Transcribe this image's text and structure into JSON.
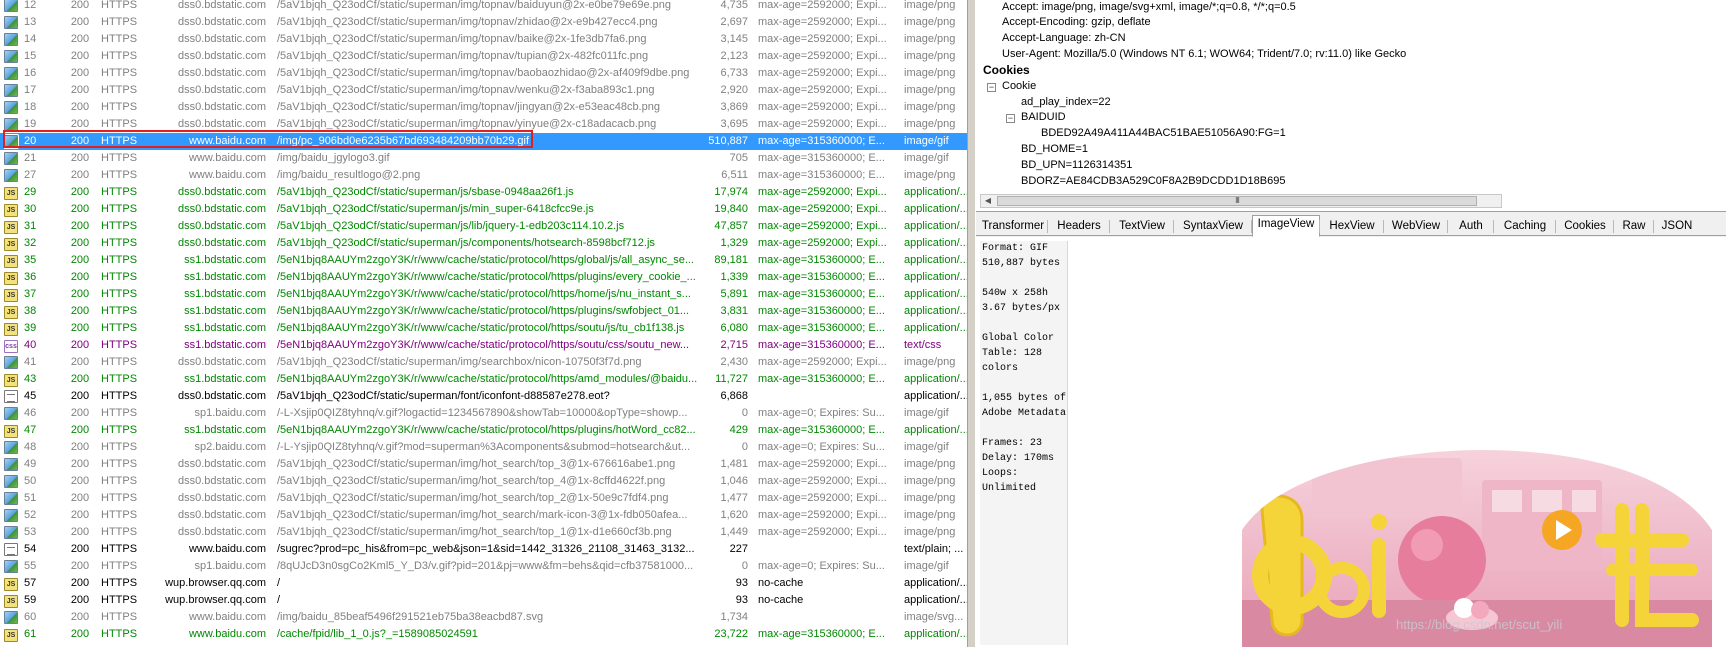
{
  "sessions": [
    {
      "num": "12",
      "result": "200",
      "protocol": "HTTPS",
      "host": "dss0.bdstatic.com",
      "url": "/5aV1bjqh_Q23odCf/static/superman/img/topnav/baiduyun@2x-e0be79e69e.png",
      "body": "4,735",
      "caching": "max-age=2592000; Expi...",
      "ctype": "image/png",
      "icon": "image-icon",
      "style": "gray"
    },
    {
      "num": "13",
      "result": "200",
      "protocol": "HTTPS",
      "host": "dss0.bdstatic.com",
      "url": "/5aV1bjqh_Q23odCf/static/superman/img/topnav/zhidao@2x-e9b427ecc4.png",
      "body": "2,697",
      "caching": "max-age=2592000; Expi...",
      "ctype": "image/png",
      "icon": "image-icon",
      "style": "gray"
    },
    {
      "num": "14",
      "result": "200",
      "protocol": "HTTPS",
      "host": "dss0.bdstatic.com",
      "url": "/5aV1bjqh_Q23odCf/static/superman/img/topnav/baike@2x-1fe3db7fa6.png",
      "body": "3,145",
      "caching": "max-age=2592000; Expi...",
      "ctype": "image/png",
      "icon": "image-icon",
      "style": "gray"
    },
    {
      "num": "15",
      "result": "200",
      "protocol": "HTTPS",
      "host": "dss0.bdstatic.com",
      "url": "/5aV1bjqh_Q23odCf/static/superman/img/topnav/tupian@2x-482fc011fc.png",
      "body": "2,123",
      "caching": "max-age=2592000; Expi...",
      "ctype": "image/png",
      "icon": "image-icon",
      "style": "gray"
    },
    {
      "num": "16",
      "result": "200",
      "protocol": "HTTPS",
      "host": "dss0.bdstatic.com",
      "url": "/5aV1bjqh_Q23odCf/static/superman/img/topnav/baobaozhidao@2x-af409f9dbe.png",
      "body": "6,733",
      "caching": "max-age=2592000; Expi...",
      "ctype": "image/png",
      "icon": "image-icon",
      "style": "gray"
    },
    {
      "num": "17",
      "result": "200",
      "protocol": "HTTPS",
      "host": "dss0.bdstatic.com",
      "url": "/5aV1bjqh_Q23odCf/static/superman/img/topnav/wenku@2x-f3aba893c1.png",
      "body": "2,920",
      "caching": "max-age=2592000; Expi...",
      "ctype": "image/png",
      "icon": "image-icon",
      "style": "gray"
    },
    {
      "num": "18",
      "result": "200",
      "protocol": "HTTPS",
      "host": "dss0.bdstatic.com",
      "url": "/5aV1bjqh_Q23odCf/static/superman/img/topnav/jingyan@2x-e53eac48cb.png",
      "body": "3,869",
      "caching": "max-age=2592000; Expi...",
      "ctype": "image/png",
      "icon": "image-icon",
      "style": "gray"
    },
    {
      "num": "19",
      "result": "200",
      "protocol": "HTTPS",
      "host": "dss0.bdstatic.com",
      "url": "/5aV1bjqh_Q23odCf/static/superman/img/topnav/yinyue@2x-c18adacacb.png",
      "body": "3,695",
      "caching": "max-age=2592000; Expi...",
      "ctype": "image/png",
      "icon": "image-icon",
      "style": "gray"
    },
    {
      "num": "20",
      "result": "200",
      "protocol": "HTTPS",
      "host": "www.baidu.com",
      "url": "/img/pc_906bd0e6235b67bd693484209bb70b29.gif",
      "body": "510,887",
      "caching": "max-age=315360000; E...",
      "ctype": "image/gif",
      "icon": "image-icon",
      "style": "selected"
    },
    {
      "num": "21",
      "result": "200",
      "protocol": "HTTPS",
      "host": "www.baidu.com",
      "url": "/img/baidu_jgylogo3.gif",
      "body": "705",
      "caching": "max-age=315360000; E...",
      "ctype": "image/gif",
      "icon": "image-icon",
      "style": "gray"
    },
    {
      "num": "27",
      "result": "200",
      "protocol": "HTTPS",
      "host": "www.baidu.com",
      "url": "/img/baidu_resultlogo@2.png",
      "body": "6,511",
      "caching": "max-age=315360000; E...",
      "ctype": "image/png",
      "icon": "image-icon",
      "style": "gray"
    },
    {
      "num": "29",
      "result": "200",
      "protocol": "HTTPS",
      "host": "dss0.bdstatic.com",
      "url": "/5aV1bjqh_Q23odCf/static/superman/js/sbase-0948aa26f1.js",
      "body": "17,974",
      "caching": "max-age=2592000; Expi...",
      "ctype": "application/...",
      "icon": "js-icon",
      "style": "green"
    },
    {
      "num": "30",
      "result": "200",
      "protocol": "HTTPS",
      "host": "dss0.bdstatic.com",
      "url": "/5aV1bjqh_Q23odCf/static/superman/js/min_super-6418cfcc9e.js",
      "body": "19,840",
      "caching": "max-age=2592000; Expi...",
      "ctype": "application/...",
      "icon": "js-icon",
      "style": "green"
    },
    {
      "num": "31",
      "result": "200",
      "protocol": "HTTPS",
      "host": "dss0.bdstatic.com",
      "url": "/5aV1bjqh_Q23odCf/static/superman/js/lib/jquery-1-edb203c114.10.2.js",
      "body": "47,857",
      "caching": "max-age=2592000; Expi...",
      "ctype": "application/...",
      "icon": "js-icon",
      "style": "green"
    },
    {
      "num": "32",
      "result": "200",
      "protocol": "HTTPS",
      "host": "dss0.bdstatic.com",
      "url": "/5aV1bjqh_Q23odCf/static/superman/js/components/hotsearch-8598bcf712.js",
      "body": "1,329",
      "caching": "max-age=2592000; Expi...",
      "ctype": "application/...",
      "icon": "js-icon",
      "style": "green"
    },
    {
      "num": "35",
      "result": "200",
      "protocol": "HTTPS",
      "host": "ss1.bdstatic.com",
      "url": "/5eN1bjq8AAUYm2zgoY3K/r/www/cache/static/protocol/https/global/js/all_async_se...",
      "body": "89,181",
      "caching": "max-age=315360000; E...",
      "ctype": "application/...",
      "icon": "js-icon",
      "style": "green"
    },
    {
      "num": "36",
      "result": "200",
      "protocol": "HTTPS",
      "host": "ss1.bdstatic.com",
      "url": "/5eN1bjq8AAUYm2zgoY3K/r/www/cache/static/protocol/https/plugins/every_cookie_...",
      "body": "1,339",
      "caching": "max-age=315360000; E...",
      "ctype": "application/...",
      "icon": "js-icon",
      "style": "green"
    },
    {
      "num": "37",
      "result": "200",
      "protocol": "HTTPS",
      "host": "ss1.bdstatic.com",
      "url": "/5eN1bjq8AAUYm2zgoY3K/r/www/cache/static/protocol/https/home/js/nu_instant_s...",
      "body": "5,891",
      "caching": "max-age=315360000; E...",
      "ctype": "application/...",
      "icon": "js-icon",
      "style": "green"
    },
    {
      "num": "38",
      "result": "200",
      "protocol": "HTTPS",
      "host": "ss1.bdstatic.com",
      "url": "/5eN1bjq8AAUYm2zgoY3K/r/www/cache/static/protocol/https/plugins/swfobject_01...",
      "body": "3,831",
      "caching": "max-age=315360000; E...",
      "ctype": "application/...",
      "icon": "js-icon",
      "style": "green"
    },
    {
      "num": "39",
      "result": "200",
      "protocol": "HTTPS",
      "host": "ss1.bdstatic.com",
      "url": "/5eN1bjq8AAUYm2zgoY3K/r/www/cache/static/protocol/https/soutu/js/tu_cb1f138.js",
      "body": "6,080",
      "caching": "max-age=315360000; E...",
      "ctype": "application/...",
      "icon": "js-icon",
      "style": "green"
    },
    {
      "num": "40",
      "result": "200",
      "protocol": "HTTPS",
      "host": "ss1.bdstatic.com",
      "url": "/5eN1bjq8AAUYm2zgoY3K/r/www/cache/static/protocol/https/soutu/css/soutu_new...",
      "body": "2,715",
      "caching": "max-age=315360000; E...",
      "ctype": "text/css",
      "icon": "css-icon",
      "style": "purple"
    },
    {
      "num": "41",
      "result": "200",
      "protocol": "HTTPS",
      "host": "dss0.bdstatic.com",
      "url": "/5aV1bjqh_Q23odCf/static/superman/img/searchbox/nicon-10750f3f7d.png",
      "body": "2,430",
      "caching": "max-age=2592000; Expi...",
      "ctype": "image/png",
      "icon": "image-icon",
      "style": "gray"
    },
    {
      "num": "43",
      "result": "200",
      "protocol": "HTTPS",
      "host": "ss1.bdstatic.com",
      "url": "/5eN1bjq8AAUYm2zgoY3K/r/www/cache/static/protocol/https/amd_modules/@baidu...",
      "body": "11,727",
      "caching": "max-age=315360000; E...",
      "ctype": "application/...",
      "icon": "js-icon",
      "style": "green"
    },
    {
      "num": "45",
      "result": "200",
      "protocol": "HTTPS",
      "host": "dss0.bdstatic.com",
      "url": "/5aV1bjqh_Q23odCf/static/superman/font/iconfont-d88587e278.eot?",
      "body": "6,868",
      "caching": "",
      "ctype": "application/...",
      "icon": "document-icon",
      "style": "black"
    },
    {
      "num": "46",
      "result": "200",
      "protocol": "HTTPS",
      "host": "sp1.baidu.com",
      "url": "/-L-Xsjip0QIZ8tyhnq/v.gif?logactid=1234567890&showTab=10000&opType=showp...",
      "body": "0",
      "caching": "max-age=0; Expires: Su...",
      "ctype": "image/gif",
      "icon": "image-icon",
      "style": "gray"
    },
    {
      "num": "47",
      "result": "200",
      "protocol": "HTTPS",
      "host": "ss1.bdstatic.com",
      "url": "/5eN1bjq8AAUYm2zgoY3K/r/www/cache/static/protocol/https/plugins/hotWord_cc82...",
      "body": "429",
      "caching": "max-age=315360000; E...",
      "ctype": "application/...",
      "icon": "js-icon",
      "style": "green"
    },
    {
      "num": "48",
      "result": "200",
      "protocol": "HTTPS",
      "host": "sp2.baidu.com",
      "url": "/-L-Ysjip0QIZ8tyhnq/v.gif?mod=superman%3Acomponents&submod=hotsearch&ut...",
      "body": "0",
      "caching": "max-age=0; Expires: Su...",
      "ctype": "image/gif",
      "icon": "image-icon",
      "style": "gray"
    },
    {
      "num": "49",
      "result": "200",
      "protocol": "HTTPS",
      "host": "dss0.bdstatic.com",
      "url": "/5aV1bjqh_Q23odCf/static/superman/img/hot_search/top_3@1x-676616abe1.png",
      "body": "1,481",
      "caching": "max-age=2592000; Expi...",
      "ctype": "image/png",
      "icon": "image-icon",
      "style": "gray"
    },
    {
      "num": "50",
      "result": "200",
      "protocol": "HTTPS",
      "host": "dss0.bdstatic.com",
      "url": "/5aV1bjqh_Q23odCf/static/superman/img/hot_search/top_4@1x-8cffd4622f.png",
      "body": "1,046",
      "caching": "max-age=2592000; Expi...",
      "ctype": "image/png",
      "icon": "image-icon",
      "style": "gray"
    },
    {
      "num": "51",
      "result": "200",
      "protocol": "HTTPS",
      "host": "dss0.bdstatic.com",
      "url": "/5aV1bjqh_Q23odCf/static/superman/img/hot_search/top_2@1x-50e9c7fdf4.png",
      "body": "1,477",
      "caching": "max-age=2592000; Expi...",
      "ctype": "image/png",
      "icon": "image-icon",
      "style": "gray"
    },
    {
      "num": "52",
      "result": "200",
      "protocol": "HTTPS",
      "host": "dss0.bdstatic.com",
      "url": "/5aV1bjqh_Q23odCf/static/superman/img/hot_search/mark-icon-3@1x-fdb050afea...",
      "body": "1,620",
      "caching": "max-age=2592000; Expi...",
      "ctype": "image/png",
      "icon": "image-icon",
      "style": "gray"
    },
    {
      "num": "53",
      "result": "200",
      "protocol": "HTTPS",
      "host": "dss0.bdstatic.com",
      "url": "/5aV1bjqh_Q23odCf/static/superman/img/hot_search/top_1@1x-d1e660cf3b.png",
      "body": "1,449",
      "caching": "max-age=2592000; Expi...",
      "ctype": "image/png",
      "icon": "image-icon",
      "style": "gray"
    },
    {
      "num": "54",
      "result": "200",
      "protocol": "HTTPS",
      "host": "www.baidu.com",
      "url": "/sugrec?prod=pc_his&from=pc_web&json=1&sid=1442_31326_21108_31463_3132...",
      "body": "227",
      "caching": "",
      "ctype": "text/plain; ...",
      "icon": "document-icon",
      "style": "black"
    },
    {
      "num": "55",
      "result": "200",
      "protocol": "HTTPS",
      "host": "sp1.baidu.com",
      "url": "/8qUJcD3n0sgCo2Kml5_Y_D3/v.gif?pid=201&pj=www&fm=behs&qid=cfb37581000...",
      "body": "0",
      "caching": "max-age=0; Expires: Su...",
      "ctype": "image/gif",
      "icon": "image-icon",
      "style": "gray"
    },
    {
      "num": "57",
      "result": "200",
      "protocol": "HTTPS",
      "host": "wup.browser.qq.com",
      "url": "/",
      "body": "93",
      "caching": "no-cache",
      "ctype": "application/...",
      "icon": "js-icon",
      "style": "black"
    },
    {
      "num": "59",
      "result": "200",
      "protocol": "HTTPS",
      "host": "wup.browser.qq.com",
      "url": "/",
      "body": "93",
      "caching": "no-cache",
      "ctype": "application/...",
      "icon": "js-icon",
      "style": "black"
    },
    {
      "num": "60",
      "result": "200",
      "protocol": "HTTPS",
      "host": "www.baidu.com",
      "url": "/img/baidu_85beaf5496f291521eb75ba38eacbd87.svg",
      "body": "1,734",
      "caching": "",
      "ctype": "image/svg...",
      "icon": "image-icon",
      "style": "gray"
    },
    {
      "num": "61",
      "result": "200",
      "protocol": "HTTPS",
      "host": "www.baidu.com",
      "url": "/cache/fpid/lib_1_0.js?_=1589085024591",
      "body": "23,722",
      "caching": "max-age=315360000; E...",
      "ctype": "application/...",
      "icon": "js-icon",
      "style": "green"
    }
  ],
  "request_headers": {
    "lines": [
      "Accept: image/png, image/svg+xml, image/*;q=0.8, */*;q=0.5",
      "Accept-Encoding: gzip, deflate",
      "Accept-Language: zh-CN",
      "User-Agent: Mozilla/5.0 (Windows NT 6.1; WOW64; Trident/7.0; rv:11.0) like Gecko"
    ],
    "cookies_title": "Cookies",
    "cookie_label": "Cookie",
    "ad_play_index": "ad_play_index=22",
    "baiduid_label": "BAIDUID",
    "baiduid_value": "BDED92A49A411A44BAC51BAE51056A90:FG=1",
    "bd_home": "BD_HOME=1",
    "bd_upn": "BD_UPN=1126314351",
    "bdorz": "BDORZ=AE84CDB3A529C0F8A2B9DCDD1D18B695",
    "scroll_thumb": "III"
  },
  "tabs": [
    {
      "label": "Transformer",
      "active": false
    },
    {
      "label": "Headers",
      "active": false
    },
    {
      "label": "TextView",
      "active": false
    },
    {
      "label": "SyntaxView",
      "active": false
    },
    {
      "label": "ImageView",
      "active": true
    },
    {
      "label": "HexView",
      "active": false
    },
    {
      "label": "WebView",
      "active": false
    },
    {
      "label": "Auth",
      "active": false
    },
    {
      "label": "Caching",
      "active": false
    },
    {
      "label": "Cookies",
      "active": false
    },
    {
      "label": "Raw",
      "active": false
    },
    {
      "label": "JSON",
      "active": false
    }
  ],
  "image_info": "Format: GIF\n510,887 bytes\n\n540w x 258h\n3.67 bytes/px\n\nGlobal Color\nTable: 128\ncolors\n\n1,055 bytes of\nAdobe Metadata\n\nFrames: 23\nDelay: 170ms\nLoops:\nUnlimited",
  "watermark": "https://blog.csdn.net/scut_yili",
  "colors": {
    "selected_row": "#3399ff",
    "gray_text": "#808080",
    "green_text": "#008800",
    "purple_text": "#800080",
    "highlight_box": "#e02020"
  }
}
